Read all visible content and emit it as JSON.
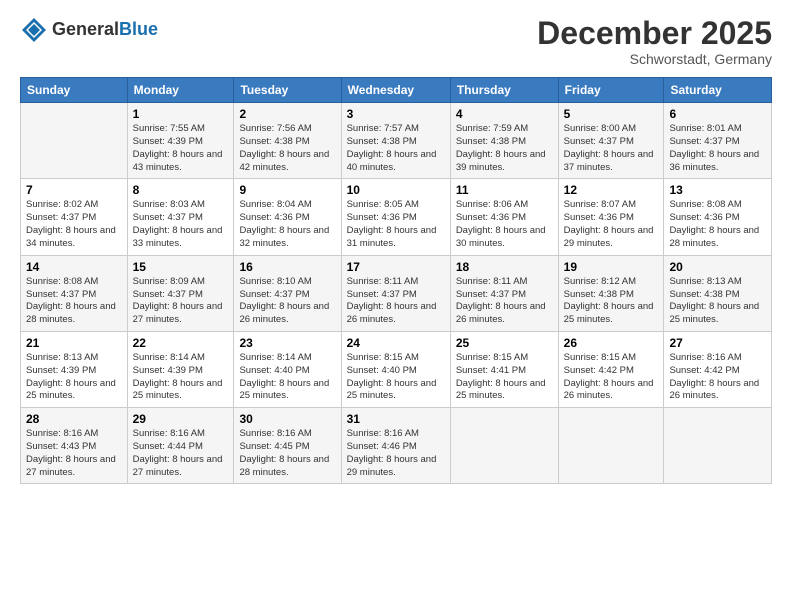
{
  "header": {
    "logo_line1": "General",
    "logo_line2": "Blue",
    "month": "December 2025",
    "location": "Schworstadt, Germany"
  },
  "days_of_week": [
    "Sunday",
    "Monday",
    "Tuesday",
    "Wednesday",
    "Thursday",
    "Friday",
    "Saturday"
  ],
  "weeks": [
    [
      {
        "num": "",
        "sunrise": "",
        "sunset": "",
        "daylight": ""
      },
      {
        "num": "1",
        "sunrise": "Sunrise: 7:55 AM",
        "sunset": "Sunset: 4:39 PM",
        "daylight": "Daylight: 8 hours and 43 minutes."
      },
      {
        "num": "2",
        "sunrise": "Sunrise: 7:56 AM",
        "sunset": "Sunset: 4:38 PM",
        "daylight": "Daylight: 8 hours and 42 minutes."
      },
      {
        "num": "3",
        "sunrise": "Sunrise: 7:57 AM",
        "sunset": "Sunset: 4:38 PM",
        "daylight": "Daylight: 8 hours and 40 minutes."
      },
      {
        "num": "4",
        "sunrise": "Sunrise: 7:59 AM",
        "sunset": "Sunset: 4:38 PM",
        "daylight": "Daylight: 8 hours and 39 minutes."
      },
      {
        "num": "5",
        "sunrise": "Sunrise: 8:00 AM",
        "sunset": "Sunset: 4:37 PM",
        "daylight": "Daylight: 8 hours and 37 minutes."
      },
      {
        "num": "6",
        "sunrise": "Sunrise: 8:01 AM",
        "sunset": "Sunset: 4:37 PM",
        "daylight": "Daylight: 8 hours and 36 minutes."
      }
    ],
    [
      {
        "num": "7",
        "sunrise": "Sunrise: 8:02 AM",
        "sunset": "Sunset: 4:37 PM",
        "daylight": "Daylight: 8 hours and 34 minutes."
      },
      {
        "num": "8",
        "sunrise": "Sunrise: 8:03 AM",
        "sunset": "Sunset: 4:37 PM",
        "daylight": "Daylight: 8 hours and 33 minutes."
      },
      {
        "num": "9",
        "sunrise": "Sunrise: 8:04 AM",
        "sunset": "Sunset: 4:36 PM",
        "daylight": "Daylight: 8 hours and 32 minutes."
      },
      {
        "num": "10",
        "sunrise": "Sunrise: 8:05 AM",
        "sunset": "Sunset: 4:36 PM",
        "daylight": "Daylight: 8 hours and 31 minutes."
      },
      {
        "num": "11",
        "sunrise": "Sunrise: 8:06 AM",
        "sunset": "Sunset: 4:36 PM",
        "daylight": "Daylight: 8 hours and 30 minutes."
      },
      {
        "num": "12",
        "sunrise": "Sunrise: 8:07 AM",
        "sunset": "Sunset: 4:36 PM",
        "daylight": "Daylight: 8 hours and 29 minutes."
      },
      {
        "num": "13",
        "sunrise": "Sunrise: 8:08 AM",
        "sunset": "Sunset: 4:36 PM",
        "daylight": "Daylight: 8 hours and 28 minutes."
      }
    ],
    [
      {
        "num": "14",
        "sunrise": "Sunrise: 8:08 AM",
        "sunset": "Sunset: 4:37 PM",
        "daylight": "Daylight: 8 hours and 28 minutes."
      },
      {
        "num": "15",
        "sunrise": "Sunrise: 8:09 AM",
        "sunset": "Sunset: 4:37 PM",
        "daylight": "Daylight: 8 hours and 27 minutes."
      },
      {
        "num": "16",
        "sunrise": "Sunrise: 8:10 AM",
        "sunset": "Sunset: 4:37 PM",
        "daylight": "Daylight: 8 hours and 26 minutes."
      },
      {
        "num": "17",
        "sunrise": "Sunrise: 8:11 AM",
        "sunset": "Sunset: 4:37 PM",
        "daylight": "Daylight: 8 hours and 26 minutes."
      },
      {
        "num": "18",
        "sunrise": "Sunrise: 8:11 AM",
        "sunset": "Sunset: 4:37 PM",
        "daylight": "Daylight: 8 hours and 26 minutes."
      },
      {
        "num": "19",
        "sunrise": "Sunrise: 8:12 AM",
        "sunset": "Sunset: 4:38 PM",
        "daylight": "Daylight: 8 hours and 25 minutes."
      },
      {
        "num": "20",
        "sunrise": "Sunrise: 8:13 AM",
        "sunset": "Sunset: 4:38 PM",
        "daylight": "Daylight: 8 hours and 25 minutes."
      }
    ],
    [
      {
        "num": "21",
        "sunrise": "Sunrise: 8:13 AM",
        "sunset": "Sunset: 4:39 PM",
        "daylight": "Daylight: 8 hours and 25 minutes."
      },
      {
        "num": "22",
        "sunrise": "Sunrise: 8:14 AM",
        "sunset": "Sunset: 4:39 PM",
        "daylight": "Daylight: 8 hours and 25 minutes."
      },
      {
        "num": "23",
        "sunrise": "Sunrise: 8:14 AM",
        "sunset": "Sunset: 4:40 PM",
        "daylight": "Daylight: 8 hours and 25 minutes."
      },
      {
        "num": "24",
        "sunrise": "Sunrise: 8:15 AM",
        "sunset": "Sunset: 4:40 PM",
        "daylight": "Daylight: 8 hours and 25 minutes."
      },
      {
        "num": "25",
        "sunrise": "Sunrise: 8:15 AM",
        "sunset": "Sunset: 4:41 PM",
        "daylight": "Daylight: 8 hours and 25 minutes."
      },
      {
        "num": "26",
        "sunrise": "Sunrise: 8:15 AM",
        "sunset": "Sunset: 4:42 PM",
        "daylight": "Daylight: 8 hours and 26 minutes."
      },
      {
        "num": "27",
        "sunrise": "Sunrise: 8:16 AM",
        "sunset": "Sunset: 4:42 PM",
        "daylight": "Daylight: 8 hours and 26 minutes."
      }
    ],
    [
      {
        "num": "28",
        "sunrise": "Sunrise: 8:16 AM",
        "sunset": "Sunset: 4:43 PM",
        "daylight": "Daylight: 8 hours and 27 minutes."
      },
      {
        "num": "29",
        "sunrise": "Sunrise: 8:16 AM",
        "sunset": "Sunset: 4:44 PM",
        "daylight": "Daylight: 8 hours and 27 minutes."
      },
      {
        "num": "30",
        "sunrise": "Sunrise: 8:16 AM",
        "sunset": "Sunset: 4:45 PM",
        "daylight": "Daylight: 8 hours and 28 minutes."
      },
      {
        "num": "31",
        "sunrise": "Sunrise: 8:16 AM",
        "sunset": "Sunset: 4:46 PM",
        "daylight": "Daylight: 8 hours and 29 minutes."
      },
      {
        "num": "",
        "sunrise": "",
        "sunset": "",
        "daylight": ""
      },
      {
        "num": "",
        "sunrise": "",
        "sunset": "",
        "daylight": ""
      },
      {
        "num": "",
        "sunrise": "",
        "sunset": "",
        "daylight": ""
      }
    ]
  ]
}
